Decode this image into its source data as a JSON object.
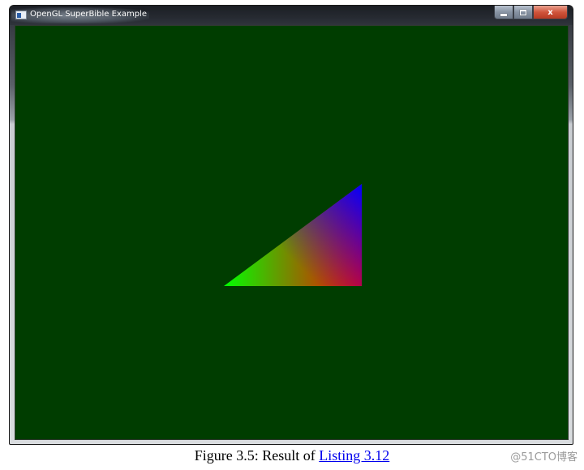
{
  "window": {
    "title": "OpenGL SuperBible Example",
    "clear_color": "#003d00",
    "controls": {
      "minimize": "minimize-icon",
      "maximize": "maximize-icon",
      "close": "close-icon",
      "close_glyph": "x"
    }
  },
  "scene": {
    "shape": "triangle",
    "vertex_colors": [
      "#00ff00",
      "#ff0000",
      "#0000ff"
    ]
  },
  "caption": {
    "prefix": "Figure 3.5: Result of ",
    "link_text": "Listing 3.12"
  },
  "watermark": "@51CTO博客"
}
